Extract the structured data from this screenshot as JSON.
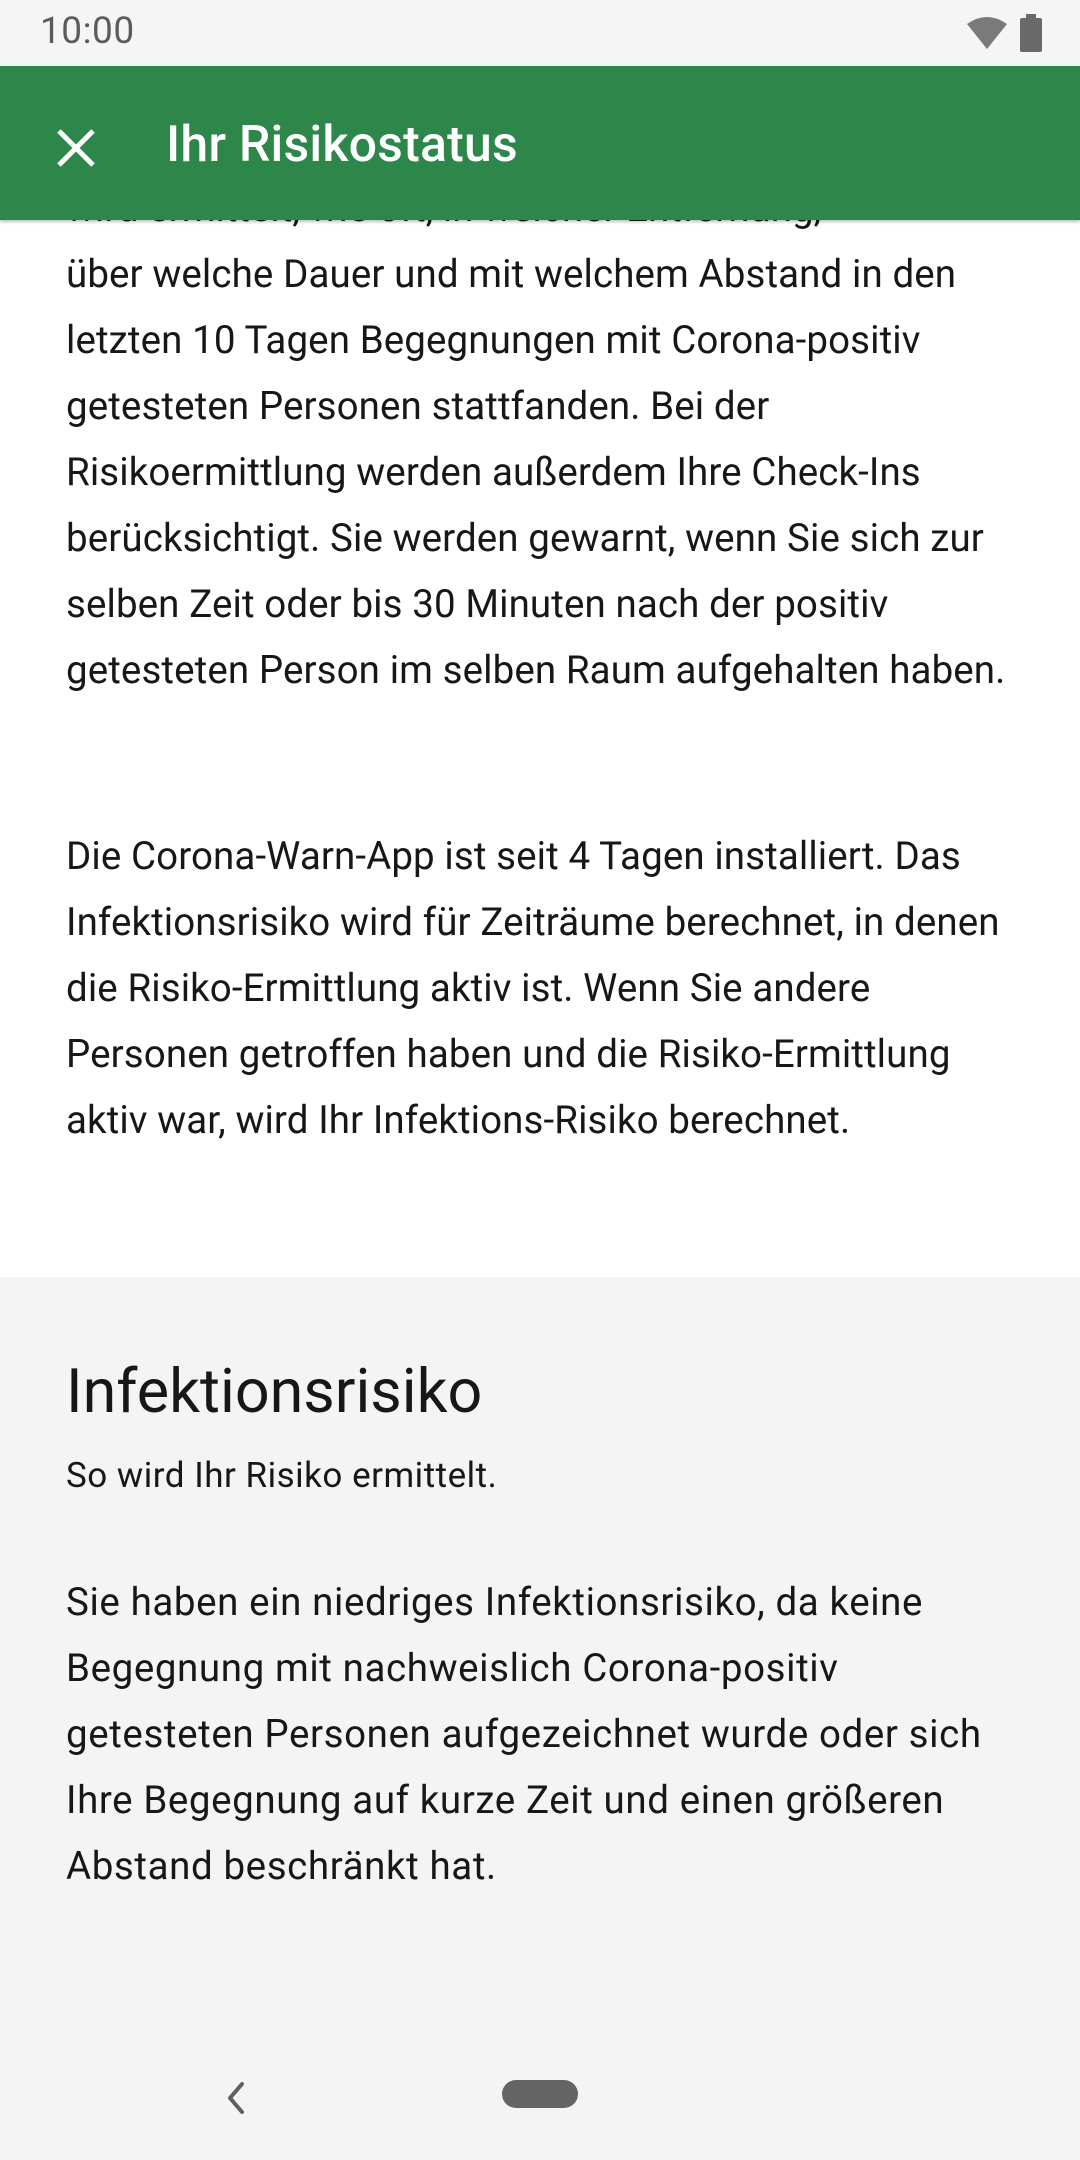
{
  "status_bar": {
    "time": "10:00"
  },
  "toolbar": {
    "title": "Ihr Risikostatus",
    "close_icon": "close-icon"
  },
  "content": {
    "partial_top_line": "wird ermittelt, wie oft, in welcher Entfernung,",
    "paragraph_1": "über welche Dauer und mit welchem Abstand in den letzten 10 Tagen Begegnungen mit Corona-positiv getesteten Personen stattfanden. Bei der Risikoermittlung werden außerdem Ihre Check-Ins berücksichtigt. Sie werden gewarnt, wenn Sie sich zur selben Zeit oder bis 30 Minuten nach der positiv getesteten Person im selben Raum aufgehalten haben.",
    "paragraph_2": "Die Corona-Warn-App ist seit 4 Tagen installiert. Das Infektionsrisiko wird für Zeiträume berechnet, in denen die Risiko-Ermittlung aktiv ist. Wenn Sie andere Personen getroffen haben und die Risiko-Ermittlung aktiv war, wird Ihr Infektions-Risiko berechnet."
  },
  "infection_section": {
    "heading": "Infektionsrisiko",
    "subtitle": "So wird Ihr Risiko ermittelt.",
    "body": "Sie haben ein niedriges Infektionsrisiko, da keine Begegnung mit nachweislich Corona-positiv getesteten Personen aufgezeichnet wurde oder sich Ihre Begegnung auf kurze Zeit und einen größeren Abstand beschränkt hat."
  },
  "colors": {
    "toolbar": "#2d874b",
    "gray_section": "#f4f4f4",
    "text": "#171717"
  }
}
